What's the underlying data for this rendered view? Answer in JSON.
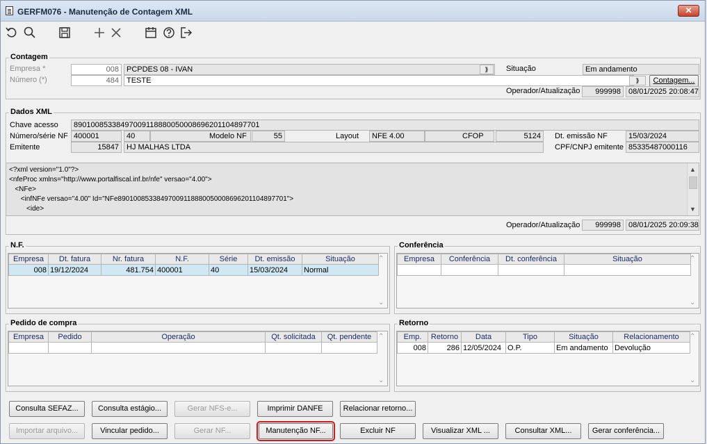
{
  "window": {
    "title": "GERFM076 - Manutenção de Contagem XML",
    "close_label": "✕"
  },
  "toolbar": {
    "icons": [
      "undo-icon",
      "search-icon",
      "save-icon",
      "add-icon",
      "delete-icon",
      "calendar-icon",
      "help-icon",
      "exit-icon"
    ]
  },
  "contagem": {
    "title": "Contagem",
    "empresa_label": "Empresa *",
    "empresa_value": "008",
    "empresa_name": "PCPDES 08 - IVAN",
    "numero_label": "Número (*)",
    "numero_value": "484",
    "numero_desc": "TESTE",
    "situacao_label": "Situação",
    "situacao_value": "Em andamento",
    "contagem_button": "Contagem...",
    "operador_label": "Operador/Atualização",
    "operador_value": "999998",
    "atualizacao_value": "08/01/2025 20:08:47"
  },
  "dados_xml": {
    "title": "Dados XML",
    "chave_label": "Chave acesso",
    "chave_value": "89010085338497009118880050008696201104897701",
    "numero_serie_label": "Número/série NF",
    "numero_value": "400001",
    "serie_value": "40",
    "modelo_label": "Modelo NF",
    "modelo_value": "55",
    "layout_label": "Layout",
    "layout_value": "NFE 4.00",
    "cfop_label": "CFOP",
    "cfop_value": "5124",
    "dt_emissao_label": "Dt. emissão NF",
    "dt_emissao_value": "15/03/2024",
    "emitente_label": "Emitente",
    "emitente_code": "15847",
    "emitente_name": "HJ MALHAS LTDA",
    "cpf_label": "CPF/CNPJ emitente",
    "cpf_value": "85335487000116",
    "xml_lines": [
      "<?xml version=\"1.0\"?>",
      "<nfeProc xmlns=\"http://www.portalfiscal.inf.br/nfe\" versao=\"4.00\">",
      "   <NFe>",
      "      <infNFe versao=\"4.00\" Id=\"NFe89010085338497009118880050008696201104897701\">",
      "         <ide>"
    ],
    "operador_label": "Operador/Atualização",
    "operador_value": "999998",
    "atualizacao_value": "08/01/2025 20:09:38"
  },
  "nf": {
    "title": "N.F.",
    "columns": [
      "Empresa",
      "Dt. fatura",
      "Nr. fatura",
      "N.F.",
      "Série",
      "Dt. emissão",
      "Situação"
    ],
    "rows": [
      [
        "008",
        "19/12/2024",
        "481.754",
        "400001",
        "40",
        "15/03/2024",
        "Normal"
      ]
    ]
  },
  "conferencia": {
    "title": "Conferência",
    "columns": [
      "Empresa",
      "Conferência",
      "Dt. conferência",
      "Situação"
    ]
  },
  "pedido": {
    "title": "Pedido de compra",
    "columns": [
      "Empresa",
      "Pedido",
      "Operação",
      "Qt. solicitada",
      "Qt. pendente"
    ]
  },
  "retorno": {
    "title": "Retorno",
    "columns": [
      "Emp.",
      "Retorno",
      "Data",
      "Tipo",
      "Situação",
      "Relacionamento"
    ],
    "rows": [
      [
        "008",
        "286",
        "12/05/2024",
        "O.P.",
        "Em andamento",
        "Devolução"
      ]
    ]
  },
  "buttons": {
    "consulta_sefaz": "Consulta SEFAZ...",
    "consulta_estagio": "Consulta estágio...",
    "gerar_nfse": "Gerar NFS-e...",
    "imprimir_danfe": "Imprimir DANFE",
    "relacionar_retorno": "Relacionar retorno...",
    "importar_arquivo": "Importar arquivo...",
    "vincular_pedido": "Vincular pedido...",
    "gerar_nf": "Gerar NF...",
    "manutencao_nf": "Manutenção NF...",
    "excluir_nf": "Excluir NF",
    "visualizar_xml": "Visualizar XML ...",
    "consultar_xml": "Consultar XML...",
    "gerar_conferencia": "Gerar conferência..."
  }
}
